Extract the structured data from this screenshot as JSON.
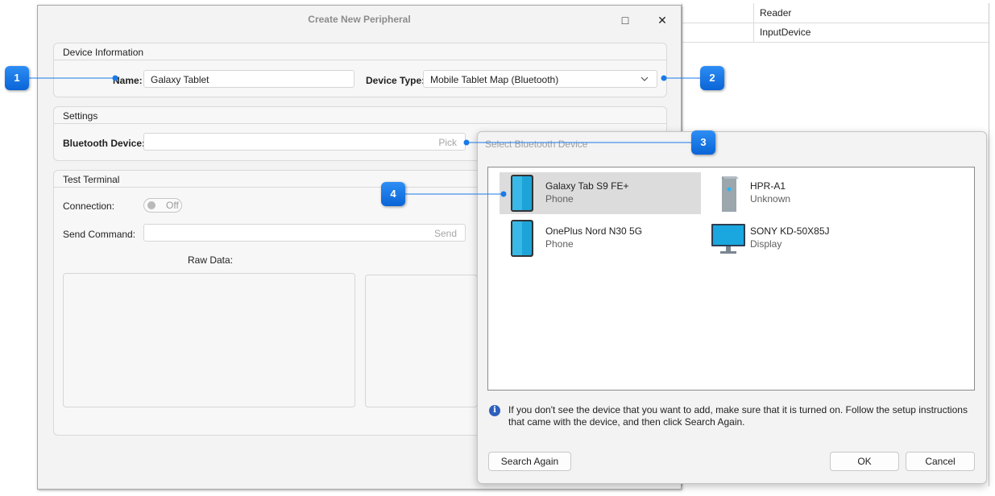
{
  "background_table": {
    "rows": [
      "Reader",
      "InputDevice"
    ]
  },
  "main_dialog": {
    "title": "Create New Peripheral",
    "maximize_glyph": "□",
    "close_glyph": "✕",
    "device_information": {
      "title": "Device Information",
      "name_label": "Name:",
      "name_value": "Galaxy Tablet",
      "device_type_label": "Device Type:",
      "device_type_value": "Mobile Tablet Map (Bluetooth)"
    },
    "settings": {
      "title": "Settings",
      "bluetooth_label": "Bluetooth Device:",
      "pick_placeholder": "Pick"
    },
    "test_terminal": {
      "title": "Test Terminal",
      "connection_label": "Connection:",
      "connection_state": "Off",
      "send_command_label": "Send Command:",
      "send_placeholder": "Send",
      "raw_data_label": "Raw Data:"
    }
  },
  "bluetooth_dialog": {
    "title": "Select Bluetooth Device",
    "devices": [
      {
        "name": "Galaxy Tab S9 FE+",
        "type": "Phone",
        "icon": "phone-icon",
        "selected": true
      },
      {
        "name": "HPR-A1",
        "type": "Unknown",
        "icon": "device-tower-icon",
        "selected": false
      },
      {
        "name": "OnePlus Nord N30 5G",
        "type": "Phone",
        "icon": "phone-icon",
        "selected": false
      },
      {
        "name": "SONY KD-50X85J",
        "type": "Display",
        "icon": "monitor-icon",
        "selected": false
      }
    ],
    "info_icon": "info-icon",
    "info_text": "If you don't see the device that you want to add, make sure that it is turned on. Follow the setup instructions that came with the device, and then click Search Again.",
    "search_again_label": "Search Again",
    "ok_label": "OK",
    "cancel_label": "Cancel"
  },
  "callouts": [
    "1",
    "2",
    "3",
    "4"
  ],
  "colors": {
    "callout": "#1a7ae8",
    "selected_row": "#dcdcdc",
    "info_icon": "#2d5fbd"
  }
}
